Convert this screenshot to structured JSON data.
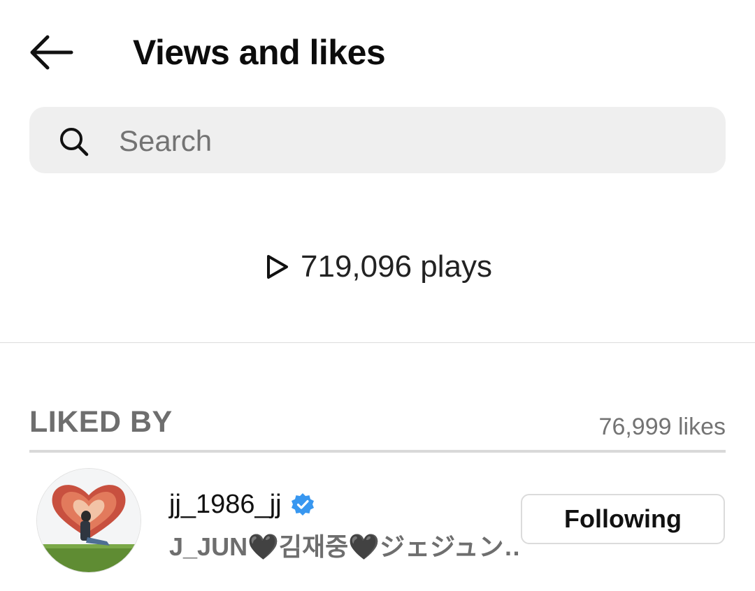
{
  "header": {
    "title": "Views and likes",
    "back_icon": "arrow-left-icon"
  },
  "search": {
    "placeholder": "Search",
    "value": "",
    "icon": "search-icon"
  },
  "stats": {
    "plays_text": "719,096 plays",
    "icon": "play-icon"
  },
  "liked_by": {
    "label": "LIKED BY",
    "count_text": "76,999 likes",
    "users": [
      {
        "username": "jj_1986_jj",
        "verified": true,
        "full_name": "J_JUN🖤김재중🖤ジェジュン…",
        "button_label": "Following"
      }
    ]
  },
  "colors": {
    "verified_badge": "#3897f0",
    "search_bg": "#efefef",
    "muted_text": "#737373"
  }
}
